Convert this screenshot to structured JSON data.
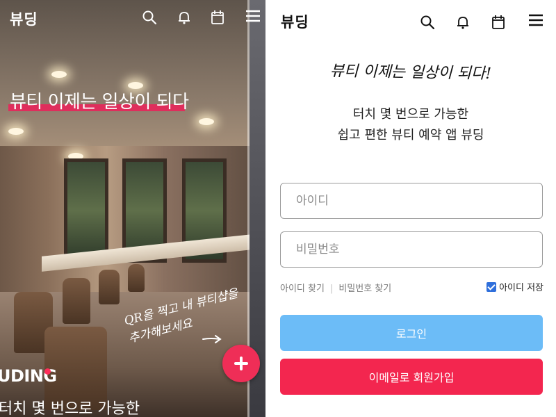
{
  "left_panel": {
    "logo": "뷰딩",
    "hero_title": "뷰티 이제는 일상이 되다",
    "handwriting_line1": "QR을 찍고 내 뷰티샵을",
    "handwriting_line2": "추가해보세요",
    "brand": "UDING",
    "bottom_text": "터치 몇 번으로 가능한",
    "icons": [
      "search-icon",
      "bell-icon",
      "calendar-icon",
      "menu-icon"
    ],
    "fab_icon": "plus-icon",
    "colors": {
      "accent": "#e8265a",
      "fab": "#ef2e57"
    }
  },
  "right_panel": {
    "logo": "뷰딩",
    "slogan": "뷰티 이제는 일상이 되다!",
    "subtitle_line1": "터치 몇 번으로 가능한",
    "subtitle_line2": "쉽고 편한 뷰티 예약 앱 뷰딩",
    "id_field": {
      "placeholder": "아이디",
      "value": ""
    },
    "password_field": {
      "placeholder": "비밀번호",
      "value": ""
    },
    "find_id": "아이디 찾기",
    "separator": "|",
    "find_password": "비밀번호 찾기",
    "save_id": {
      "label": "아이디 저장",
      "checked": true
    },
    "login_button": "로그인",
    "signup_button": "이메일로 회원가입",
    "icons": [
      "search-icon",
      "bell-icon",
      "calendar-icon",
      "menu-icon"
    ],
    "colors": {
      "login": "#6cbcf7",
      "signup": "#f3264f",
      "checkbox": "#2f6fdb"
    }
  }
}
